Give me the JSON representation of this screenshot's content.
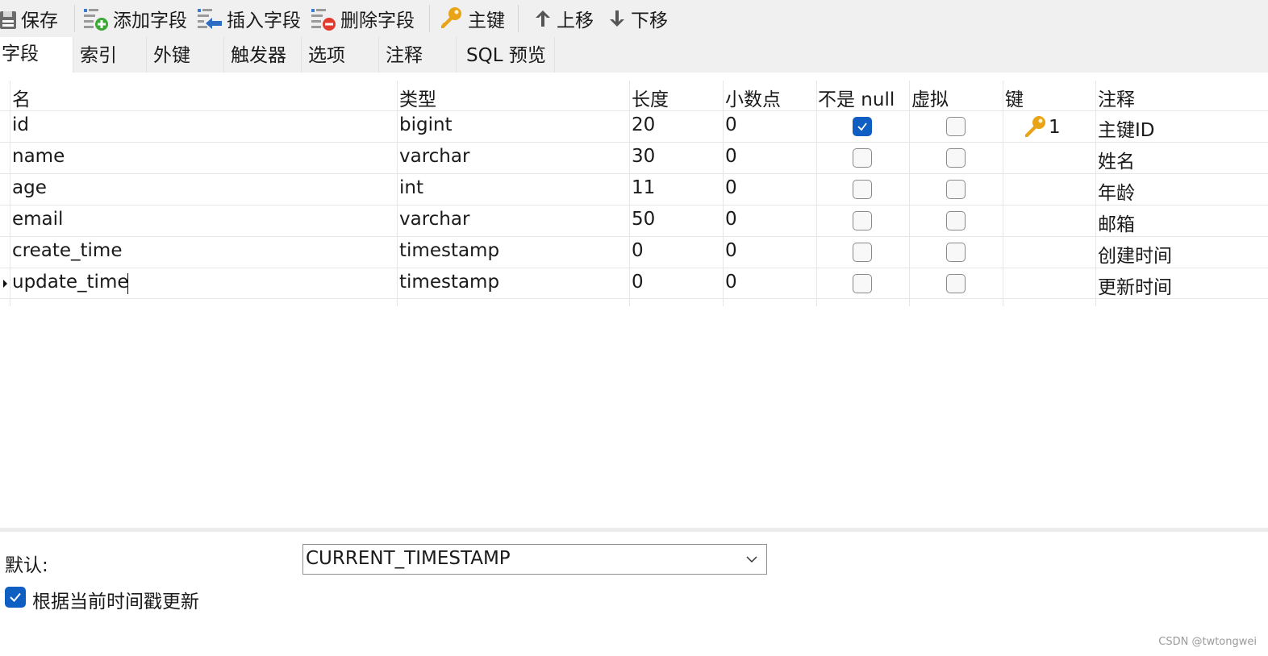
{
  "toolbar": {
    "save": "保存",
    "add_field": "添加字段",
    "insert_field": "插入字段",
    "delete_field": "删除字段",
    "primary_key": "主键",
    "move_up": "上移",
    "move_down": "下移"
  },
  "tabs": [
    "字段",
    "索引",
    "外键",
    "触发器",
    "选项",
    "注释",
    "SQL 预览"
  ],
  "active_tab": "字段",
  "columns": [
    "名",
    "类型",
    "长度",
    "小数点",
    "不是 null",
    "虚拟",
    "键",
    "注释"
  ],
  "rows": [
    {
      "name": "id",
      "type": "bigint",
      "length": "20",
      "decimals": "0",
      "not_null": true,
      "virtual": false,
      "key": "1",
      "comment": "主键ID"
    },
    {
      "name": "name",
      "type": "varchar",
      "length": "30",
      "decimals": "0",
      "not_null": false,
      "virtual": false,
      "key": "",
      "comment": "姓名"
    },
    {
      "name": "age",
      "type": "int",
      "length": "11",
      "decimals": "0",
      "not_null": false,
      "virtual": false,
      "key": "",
      "comment": "年龄"
    },
    {
      "name": "email",
      "type": "varchar",
      "length": "50",
      "decimals": "0",
      "not_null": false,
      "virtual": false,
      "key": "",
      "comment": "邮箱"
    },
    {
      "name": "create_time",
      "type": "timestamp",
      "length": "0",
      "decimals": "0",
      "not_null": false,
      "virtual": false,
      "key": "",
      "comment": "创建时间"
    },
    {
      "name": "update_time",
      "type": "timestamp",
      "length": "0",
      "decimals": "0",
      "not_null": false,
      "virtual": false,
      "key": "",
      "comment": "更新时间"
    }
  ],
  "selected_row": "update_time",
  "properties": {
    "default_label": "默认:",
    "default_value": "CURRENT_TIMESTAMP",
    "on_update_label": "根据当前时间戳更新",
    "on_update_checked": true
  },
  "watermark": "CSDN @twtongwei",
  "colors": {
    "accent": "#0f5fc2",
    "toolbar_bg": "#f0f0f0",
    "key_gold": "#e8a316",
    "add_green": "#3aa935",
    "delete_red": "#e23b2e",
    "insert_blue": "#2b6cc4"
  }
}
